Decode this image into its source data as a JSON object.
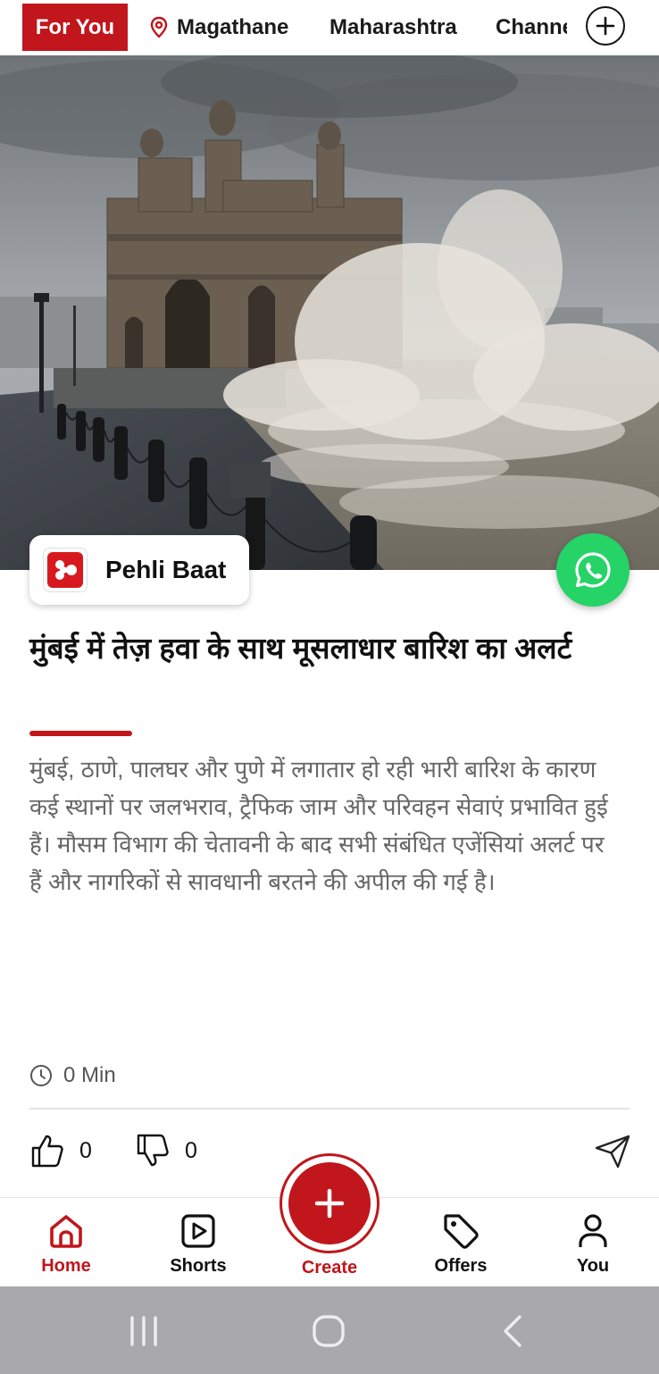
{
  "tabs": {
    "active": "For You",
    "location": "Magathane",
    "state": "Maharashtra",
    "channel": "Channe"
  },
  "publisher": {
    "name": "Pehli Baat"
  },
  "article": {
    "headline": "मुंबई में तेज़ हवा के साथ मूसलाधार बारिश का अलर्ट",
    "summary": "मुंबई, ठाणे, पालघर और पुणे में लगातार हो रही भारी बारिश के कारण कई स्थानों पर जलभराव, ट्रैफिक जाम और परिवहन सेवाएं प्रभावित हुई हैं। मौसम विभाग की चेतावनी के बाद सभी संबंधित एजेंसियां अलर्ट पर हैं और नागरिकों से सावधानी बरतने की अपील की गई है।",
    "read_time": "0 Min",
    "likes": "0",
    "dislikes": "0"
  },
  "nav": {
    "home": "Home",
    "shorts": "Shorts",
    "create": "Create",
    "offers": "Offers",
    "you": "You"
  },
  "colors": {
    "accent": "#c0161c",
    "whatsapp": "#25d366",
    "system_bar": "#a9a9ab"
  }
}
